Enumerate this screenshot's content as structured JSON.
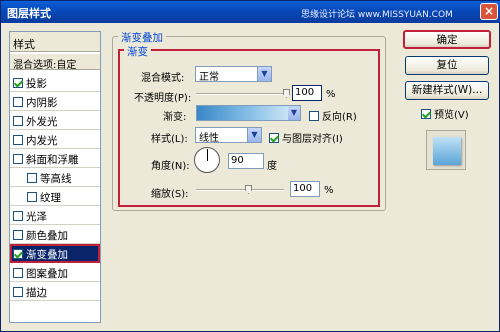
{
  "window": {
    "title": "图层样式",
    "watermark": "思缘设计论坛 www.MISSYUAN.COM"
  },
  "styles_panel": {
    "header": "样式",
    "blend_options": "混合选项:自定",
    "items": [
      {
        "label": "投影",
        "checked": true,
        "sub": false
      },
      {
        "label": "内阴影",
        "checked": false,
        "sub": false
      },
      {
        "label": "外发光",
        "checked": false,
        "sub": false
      },
      {
        "label": "内发光",
        "checked": false,
        "sub": false
      },
      {
        "label": "斜面和浮雕",
        "checked": false,
        "sub": false
      },
      {
        "label": "等高线",
        "checked": false,
        "sub": true
      },
      {
        "label": "纹理",
        "checked": false,
        "sub": true
      },
      {
        "label": "光泽",
        "checked": false,
        "sub": false
      },
      {
        "label": "颜色叠加",
        "checked": false,
        "sub": false
      },
      {
        "label": "渐变叠加",
        "checked": true,
        "sub": false,
        "selected": true
      },
      {
        "label": "图案叠加",
        "checked": false,
        "sub": false
      },
      {
        "label": "描边",
        "checked": false,
        "sub": false
      }
    ]
  },
  "gradient_overlay": {
    "group_title": "渐变叠加",
    "sub_title": "渐变",
    "blend_mode_label": "混合模式:",
    "blend_mode_value": "正常",
    "opacity_label": "不透明度(P):",
    "opacity_value": "100",
    "opacity_unit": "%",
    "gradient_label": "渐变:",
    "reverse_label": "反向(R)",
    "reverse_checked": false,
    "style_label": "样式(L):",
    "style_value": "线性",
    "align_label": "与图层对齐(I)",
    "align_checked": true,
    "angle_label": "角度(N):",
    "angle_value": "90",
    "angle_unit": "度",
    "scale_label": "缩放(S):",
    "scale_value": "100",
    "scale_unit": "%"
  },
  "buttons": {
    "ok": "确定",
    "reset": "复位",
    "new_style": "新建样式(W)...",
    "preview_label": "预览(V)",
    "preview_checked": true
  }
}
